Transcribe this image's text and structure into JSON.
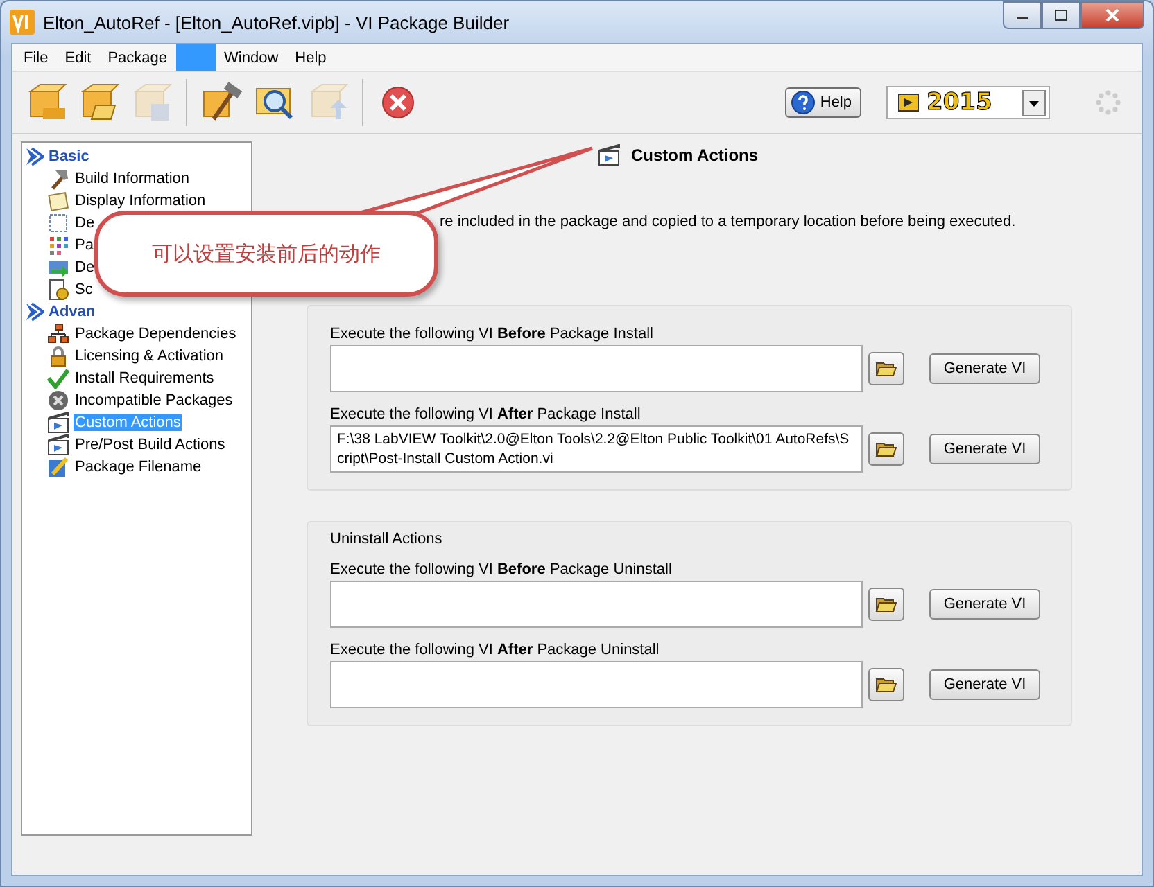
{
  "window": {
    "title": "Elton_AutoRef - [Elton_AutoRef.vipb] - VI Package Builder"
  },
  "menu": [
    {
      "label": "File",
      "selected": false
    },
    {
      "label": "Edit",
      "selected": false
    },
    {
      "label": "Package",
      "selected": false
    },
    {
      "selected": true
    },
    {
      "label": "Window",
      "selected": false
    },
    {
      "label": "Help",
      "selected": false
    }
  ],
  "toolbar": {
    "tools": [
      {
        "kind": "new",
        "disabled": false
      },
      {
        "kind": "open",
        "disabled": false
      },
      {
        "kind": "save",
        "disabled": true
      },
      {
        "kind": "separator"
      },
      {
        "kind": "build",
        "disabled": false
      },
      {
        "kind": "inspect",
        "disabled": false
      },
      {
        "kind": "publish",
        "disabled": true
      },
      {
        "kind": "separator"
      },
      {
        "kind": "stop",
        "disabled": false
      }
    ],
    "help_button": "Help",
    "version": "2015"
  },
  "sidebar": {
    "sections": [
      {
        "label": "Basic",
        "items": [
          {
            "label": "Build Information",
            "selected": false
          },
          {
            "label": "Display Information",
            "selected": false
          },
          {
            "label": "De",
            "selected": false
          },
          {
            "label": "Pa",
            "selected": false
          },
          {
            "label": "De",
            "selected": false
          },
          {
            "label": "Sc",
            "selected": false
          }
        ]
      },
      {
        "label": "Advan",
        "items": [
          {
            "label": "Package Dependencies",
            "selected": false
          },
          {
            "label": "Licensing & Activation",
            "selected": false
          },
          {
            "label": "Install Requirements",
            "selected": false
          },
          {
            "label": "Incompatible Packages",
            "selected": false
          },
          {
            "label": "Custom Actions",
            "selected": true
          },
          {
            "label": "Pre/Post Build Actions",
            "selected": false
          },
          {
            "label": "Package Filename",
            "selected": false
          }
        ]
      }
    ]
  },
  "page": {
    "title": "Custom Actions",
    "description": "re included in the package and copied to a temporary location before being executed.",
    "groups": [
      {
        "actions": [
          {
            "label": "Execute the following VI **Before** Package Install",
            "button": "Generate VI"
          },
          {
            "label": "Execute the following VI **After** Package Install",
            "value": "F:\\38 LabVIEW Toolkit\\2.0@Elton Tools\\2.2@Elton Public Toolkit\\01 AutoRefs\\Script\\Post-Install Custom Action.vi",
            "button": "Generate VI"
          }
        ]
      },
      {
        "title": "Uninstall Actions",
        "actions": [
          {
            "label": "Execute the following VI **Before** Package Uninstall",
            "button": "Generate VI"
          },
          {
            "label": "Execute the following VI **After** Package Uninstall",
            "button": "Generate VI"
          }
        ]
      }
    ]
  },
  "callout": {
    "text": "可以设置安装前后的动作"
  }
}
